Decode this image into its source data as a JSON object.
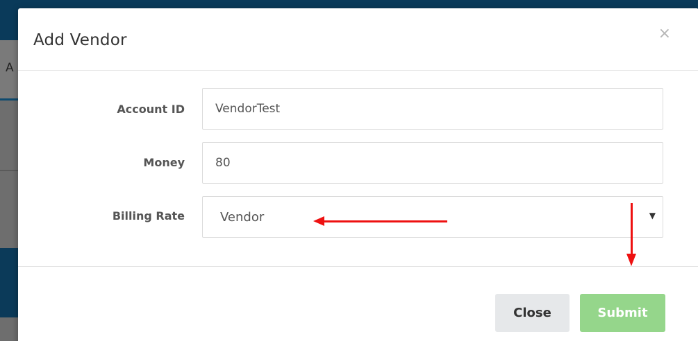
{
  "background": {
    "tab_letter": "A"
  },
  "modal": {
    "title": "Add Vendor",
    "close_icon": "×",
    "fields": {
      "account_id": {
        "label": "Account ID",
        "value": "VendorTest"
      },
      "money": {
        "label": "Money",
        "value": "80"
      },
      "billing_rate": {
        "label": "Billing Rate",
        "value": "Vendor",
        "caret": "▼"
      }
    },
    "footer": {
      "close_label": "Close",
      "submit_label": "Submit"
    }
  },
  "colors": {
    "submit_button": "#95d68b",
    "close_button": "#e6e8ea",
    "annotation_arrow": "#ee1111",
    "topbar": "#0a3a5a"
  },
  "icons": {
    "close": "close-icon",
    "dropdown": "chevron-down-icon"
  }
}
